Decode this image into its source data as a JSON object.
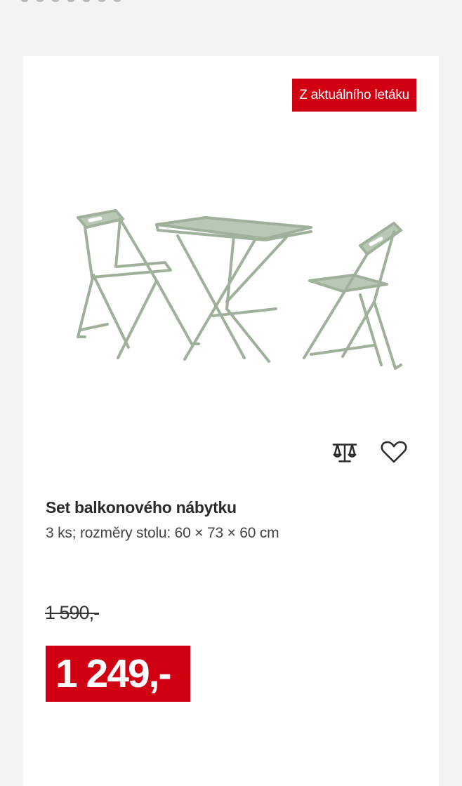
{
  "badge": {
    "label": "Z aktuálního letáku",
    "color": "#d00012"
  },
  "product": {
    "image_alt": "Set balkonového nábytku",
    "title": "Set balkonového nábytku",
    "subtitle": "3 ks; rozměry stolu: 60 × 73 × 60 cm",
    "old_price": "1 590,-",
    "price": "1 249,-",
    "price_color": "#d00012",
    "furniture_color": "#9fb09b"
  },
  "actions": [
    {
      "icon": "compare-scale-icon"
    },
    {
      "icon": "heart-icon"
    }
  ]
}
